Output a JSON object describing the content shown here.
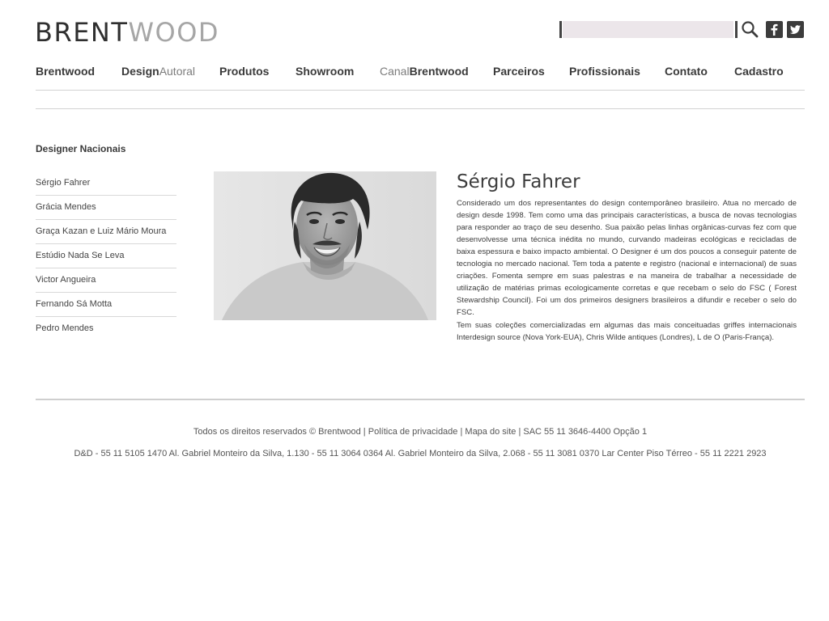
{
  "header": {
    "logo_part1": "BRENT",
    "logo_part2": "WOOD",
    "search": {
      "placeholder": "",
      "value": ""
    },
    "icons": {
      "search": "search-icon",
      "facebook": "facebook-icon",
      "twitter": "twitter-icon"
    }
  },
  "nav": [
    {
      "bold": "Brentwood",
      "light": ""
    },
    {
      "bold": "Design",
      "light": "Autoral"
    },
    {
      "bold": "Produtos",
      "light": ""
    },
    {
      "bold": "Showroom",
      "light": ""
    },
    {
      "light_prefix": "Canal",
      "bold": "Brentwood"
    },
    {
      "bold": "Parceiros",
      "light": ""
    },
    {
      "bold": "Profissionais",
      "light": ""
    },
    {
      "bold": "Contato",
      "light": ""
    },
    {
      "bold": "Cadastro",
      "light": ""
    }
  ],
  "sidebar": {
    "title": "Designer Nacionais",
    "items": [
      "Sérgio Fahrer",
      "Grácia Mendes",
      "Graça Kazan e Luiz Mário Moura",
      "Estúdio Nada Se Leva",
      "Victor Angueira",
      "Fernando Sá Motta",
      "Pedro Mendes"
    ]
  },
  "bio": {
    "name": "Sérgio Fahrer",
    "paragraphs": [
      "Considerado um dos representantes do design contemporâneo brasileiro. Atua no mercado de design desde 1998. Tem como uma das principais características, a busca de novas tecnologias para responder ao traço de seu desenho. Sua paixão pelas linhas orgânicas-curvas fez com que desenvolvesse uma técnica inédita no mundo, curvando madeiras ecológicas e recicladas de baixa espessura e baixo impacto ambiental. O Designer é um dos poucos a conseguir patente de tecnologia no mercado nacional. Tem toda a patente e registro (nacional e internacional) de suas criações. Fomenta sempre em suas palestras e na maneira de trabalhar a necessidade de utilização de matérias primas ecologicamente corretas e que recebam o selo do FSC ( Forest Stewardship Council). Foi um dos primeiros designers brasileiros a difundir e receber o selo do FSC.",
      "Tem suas coleções comercializadas em algumas das mais conceituadas griffes internacionais Interdesign source (Nova York-EUA), Chris Wilde antiques (Londres), L de O (Paris-França)."
    ]
  },
  "footer": {
    "rights": "Todos os direitos reservados © Brentwood",
    "sep": " | ",
    "privacy": "Política de privacidade",
    "sitemap": "Mapa do site",
    "sac": "SAC 55 11 3646-4400 Opção 1",
    "addresses": "D&D - 55 11 5105 1470 Al. Gabriel Monteiro da Silva, 1.130 - 55 11 3064 0364 Al. Gabriel Monteiro da Silva, 2.068 - 55 11 3081 0370 Lar Center Piso Térreo - 55 11 2221 2923"
  },
  "colors": {
    "text": "#333333",
    "muted": "#a6a6a6",
    "rule": "#d2d2d2",
    "search_bg": "#ece6ea"
  }
}
